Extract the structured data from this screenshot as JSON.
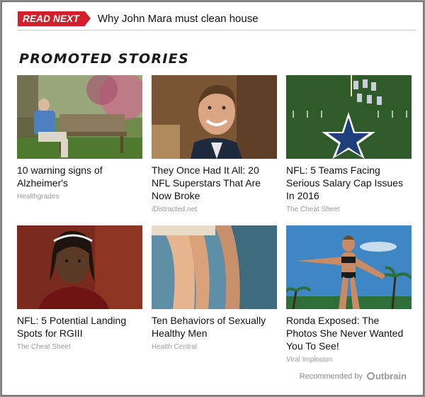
{
  "read_next": {
    "badge": "READ NEXT",
    "headline": "Why John Mara must clean house"
  },
  "section_title": "PROMOTED STORIES",
  "stories": [
    {
      "title": "10 warning signs of Alzheimer's",
      "source": "Healthgrades",
      "image": "elderly-man-on-bench"
    },
    {
      "title": "They Once Had It All: 20 NFL Superstars That Are Now Broke",
      "source": "iDistracted.net",
      "image": "smiling-man-portrait"
    },
    {
      "title": "NFL: 5 Teams Facing Serious Salary Cap Issues In 2016",
      "source": "The Cheat Sheet",
      "image": "football-field-star-logo"
    },
    {
      "title": "NFL: 5 Potential Landing Spots for RGIII",
      "source": "The Cheat Sheet",
      "image": "football-player-portrait"
    },
    {
      "title": "Ten Behaviors of Sexually Healthy Men",
      "source": "Health Central",
      "image": "couple-legs"
    },
    {
      "title": "Ronda Exposed: The Photos She Never Wanted You To See!",
      "source": "Viral Implosion",
      "image": "woman-beach-pose"
    }
  ],
  "recommended": {
    "label": "Recommended by",
    "brand": "utbrain"
  },
  "colors": {
    "badge_red": "#d0202e",
    "source_gray": "#9a9a9a"
  }
}
